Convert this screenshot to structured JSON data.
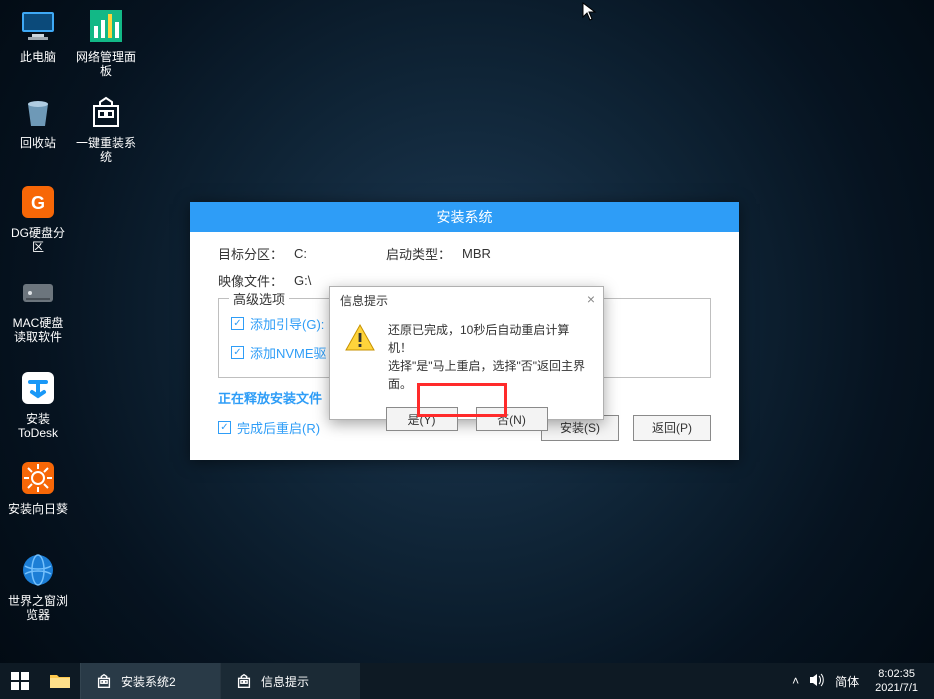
{
  "desktop": {
    "icons": [
      {
        "label": "此电脑"
      },
      {
        "label": "网络管理面板"
      },
      {
        "label": "回收站"
      },
      {
        "label": "一键重装系统"
      },
      {
        "label": "DG硬盘分区"
      },
      {
        "label": "MAC硬盘读取软件"
      },
      {
        "label": "安装ToDesk"
      },
      {
        "label": "安装向日葵"
      },
      {
        "label": "世界之窗浏览器"
      }
    ]
  },
  "installer": {
    "title": "安装系统",
    "target_label": "目标分区：",
    "target_value": "C:",
    "boot_label": "启动类型：",
    "boot_value": "MBR",
    "image_label": "映像文件：",
    "image_value": "G:\\",
    "adv_legend": "高级选项",
    "chk_boot": "添加引导(G):",
    "chk_nvme": "添加NVME驱",
    "drive_box": "",
    "progress": "正在释放安装文件",
    "chk_restart": "完成后重启(R)",
    "btn_install": "安装(S)",
    "btn_back": "返回(P)"
  },
  "modal": {
    "title": "信息提示",
    "line1": "还原已完成，10秒后自动重启计算机！",
    "line2": "选择\"是\"马上重启，选择\"否\"返回主界面。",
    "btn_yes": "是(Y)",
    "btn_no": "否(N)"
  },
  "taskbar": {
    "item1": "安装系统2",
    "item2": "信息提示",
    "ime": "简体",
    "time": "8:02:35",
    "date": "2021/7/1"
  }
}
